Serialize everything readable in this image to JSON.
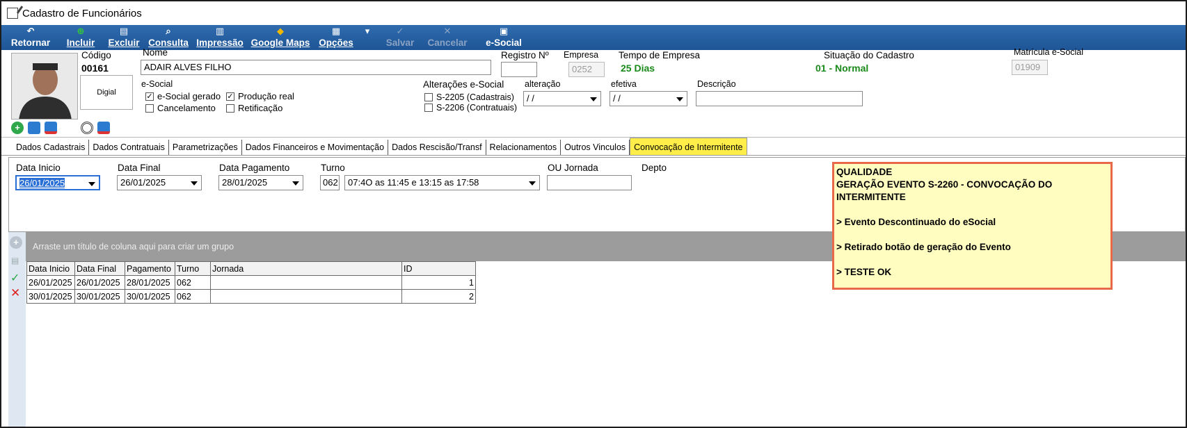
{
  "window": {
    "title": "Cadastro de Funcionários"
  },
  "toolbar": {
    "items": [
      {
        "icon": "undo-icon",
        "label": "Retornar",
        "enabled": true
      },
      {
        "icon": "plus-circle-icon",
        "label": "Incluir",
        "enabled": true
      },
      {
        "icon": "trash-icon",
        "label": "Excluir",
        "enabled": true
      },
      {
        "icon": "search-icon",
        "label": "Consulta",
        "enabled": true
      },
      {
        "icon": "printer-icon",
        "label": "Impressão",
        "enabled": true
      },
      {
        "icon": "map-pin-icon",
        "label": "Google Maps",
        "enabled": true
      },
      {
        "icon": "grid-icon",
        "label": "Opções",
        "enabled": true
      },
      {
        "icon": "check-icon",
        "label": "Salvar",
        "enabled": false
      },
      {
        "icon": "x-icon",
        "label": "Cancelar",
        "enabled": false
      },
      {
        "icon": "document-icon",
        "label": "e-Social",
        "enabled": true
      }
    ]
  },
  "employee": {
    "codigo_label": "Código",
    "codigo": "00161",
    "digital_label": "Digial",
    "nome_label": "Nome",
    "nome": "ADAIR ALVES FILHO",
    "registro_label": "Registro Nº",
    "registro": "",
    "empresa_label": "Empresa",
    "empresa": "0252",
    "tempo_label": "Tempo de Empresa",
    "tempo": "25 Dias",
    "situacao_label": "Situação do Cadastro",
    "situacao": "01 - Normal",
    "matricula_label": "Matrícula e-Social",
    "matricula": "01909"
  },
  "esocial": {
    "label": "e-Social",
    "gerado": {
      "label": "e-Social gerado",
      "checked": true
    },
    "producao": {
      "label": "Produção real",
      "checked": true
    },
    "cancelamento": {
      "label": "Cancelamento",
      "checked": false
    },
    "retificacao": {
      "label": "Retificação",
      "checked": false
    }
  },
  "alteracoes": {
    "label": "Alterações e-Social",
    "s2205": "S-2205 (Cadastrais)",
    "s2206": "S-2206 (Contratuais)",
    "alteracao_label": "alteração",
    "alteracao_value": "/ /",
    "efetiva_label": "efetiva",
    "efetiva_value": "/ /",
    "descricao_label": "Descrição",
    "descricao_value": ""
  },
  "tabs": [
    "Dados Cadastrais",
    "Dados Contratuais",
    "Parametrizações",
    "Dados Financeiros e Movimentação",
    "Dados Rescisão/Transf",
    "Relacionamentos",
    "Outros Vinculos",
    "Convocação de Intermitente"
  ],
  "form": {
    "data_inicio_label": "Data Inicio",
    "data_inicio": "26/01/2025",
    "data_final_label": "Data Final",
    "data_final": "26/01/2025",
    "data_pagamento_label": "Data Pagamento",
    "data_pagamento": "28/01/2025",
    "turno_label": "Turno",
    "turno_code": "062",
    "turno_desc": "07:4O as  11:45 e 13:15  as 17:58",
    "jornada_label": "OU Jornada",
    "jornada": "",
    "depto_label": "Depto"
  },
  "grid": {
    "group_hint": "Arraste um título de coluna aqui para criar um grupo",
    "columns": [
      "Data Inicio",
      "Data Final",
      "Pagamento",
      "Turno",
      "Jornada",
      "ID"
    ],
    "rows": [
      [
        "26/01/2025",
        "26/01/2025",
        "28/01/2025",
        "062",
        "",
        "1"
      ],
      [
        "30/01/2025",
        "30/01/2025",
        "30/01/2025",
        "062",
        "",
        "2"
      ]
    ]
  },
  "note": {
    "lines": [
      "QUALIDADE",
      "GERAÇÃO EVENTO S-2260 - CONVOCAÇÃO DO INTERMITENTE",
      "",
      "> Evento Descontinuado do eSocial",
      "",
      "> Retirado botão de geração do Evento",
      "",
      "> TESTE OK"
    ]
  },
  "colors": {
    "toolbar": "#1e5596",
    "active_tab": "#ffee4a",
    "note_bg": "#fffdc0",
    "note_border": "#e8694a",
    "green_text": "#1a8a1a"
  }
}
